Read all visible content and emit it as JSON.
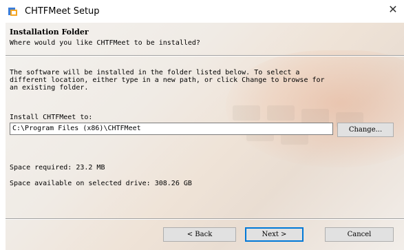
{
  "window": {
    "title": "CHTFMeet Setup",
    "close_glyph": "✕",
    "app_icon": "setup-installer-icon"
  },
  "header": {
    "title": "Installation Folder",
    "subtitle": "Where would you like CHTFMeet to be installed?"
  },
  "description": {
    "line1": "The software will be installed in the folder listed below. To select a",
    "line2": "different location, either type in a new path, or click Change to browse for",
    "line3": "an existing folder."
  },
  "install_to": {
    "label": "Install CHTFMeet to:",
    "path": "C:\\Program Files (x86)\\CHTFMeet",
    "change_button": "Change..."
  },
  "space": {
    "required": "Space required: 23.2 MB",
    "available": "Space available on selected drive: 308.26 GB"
  },
  "buttons": {
    "back": "< Back",
    "next": "Next >",
    "cancel": "Cancel"
  },
  "colors": {
    "accent_border": "#0078d7",
    "button_face": "#e1e1e1"
  }
}
